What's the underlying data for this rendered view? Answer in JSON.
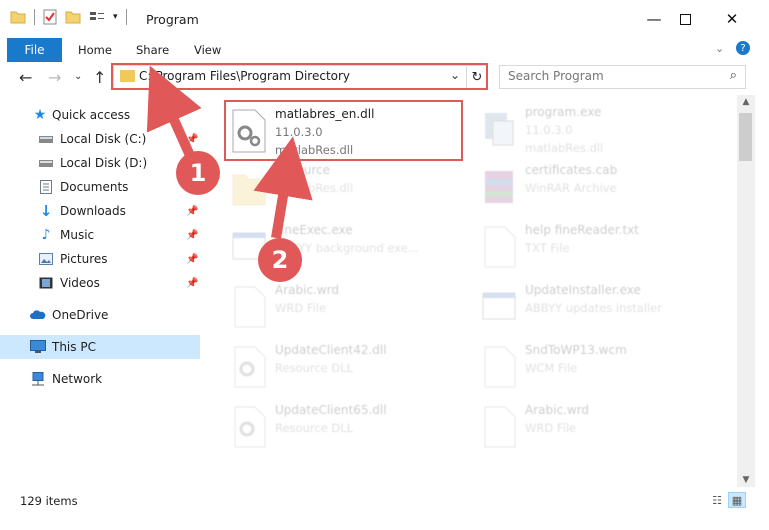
{
  "window": {
    "title": "Program",
    "minimize_icon": "minimize-icon",
    "maximize_icon": "maximize-icon",
    "close_icon": "close-icon"
  },
  "ribbon": {
    "tabs": [
      "File",
      "Home",
      "Share",
      "View"
    ],
    "help_icon": "help-icon",
    "expand_icon": "chevron-down-icon"
  },
  "address": {
    "path": "C:\\Program Files\\Program Directory"
  },
  "search": {
    "placeholder": "Search Program"
  },
  "sidebar": {
    "items": [
      {
        "label": "Quick access",
        "icon": "star-icon"
      },
      {
        "label": "Local Disk (C:)",
        "icon": "drive-icon"
      },
      {
        "label": "Local Disk (D:)",
        "icon": "drive-icon"
      },
      {
        "label": "Documents",
        "icon": "documents-icon"
      },
      {
        "label": "Downloads",
        "icon": "download-icon"
      },
      {
        "label": "Music",
        "icon": "music-icon"
      },
      {
        "label": "Pictures",
        "icon": "pictures-icon"
      },
      {
        "label": "Videos",
        "icon": "videos-icon"
      },
      {
        "label": "OneDrive",
        "icon": "cloud-icon"
      },
      {
        "label": "This PC",
        "icon": "computer-icon"
      },
      {
        "label": "Network",
        "icon": "network-icon"
      }
    ]
  },
  "files": [
    {
      "name": "matlabres_en.dll",
      "line2": "11.0.3.0",
      "line3": "matlabRes.dll"
    },
    {
      "name": "program.exe",
      "line2": "11.0.3.0",
      "line3": "matlabRes.dll"
    },
    {
      "name": "Resource",
      "line2": "matlabRes.dll",
      "line3": ""
    },
    {
      "name": "certificates.cab",
      "line2": "WinRAR Archive",
      "line3": ""
    },
    {
      "name": "FineExec.exe",
      "line2": "ABBYY background exe...",
      "line3": ""
    },
    {
      "name": "help fineReader.txt",
      "line2": "TXT File",
      "line3": ""
    },
    {
      "name": "Arabic.wrd",
      "line2": "WRD File",
      "line3": ""
    },
    {
      "name": "UpdateInstaller.exe",
      "line2": "ABBYY updates installer",
      "line3": ""
    },
    {
      "name": "UpdateClient42.dll",
      "line2": "Resource DLL",
      "line3": ""
    },
    {
      "name": "SndToWP13.wcm",
      "line2": "WCM File",
      "line3": ""
    },
    {
      "name": "UpdateClient65.dll",
      "line2": "Resource DLL",
      "line3": ""
    },
    {
      "name": "Arabic.wrd",
      "line2": "WRD File",
      "line3": ""
    }
  ],
  "status": {
    "item_count": "129 items"
  },
  "callouts": [
    "1",
    "2"
  ],
  "colors": {
    "accent": "#1979ca",
    "highlight": "#e05858",
    "selected": "#cce8ff"
  }
}
